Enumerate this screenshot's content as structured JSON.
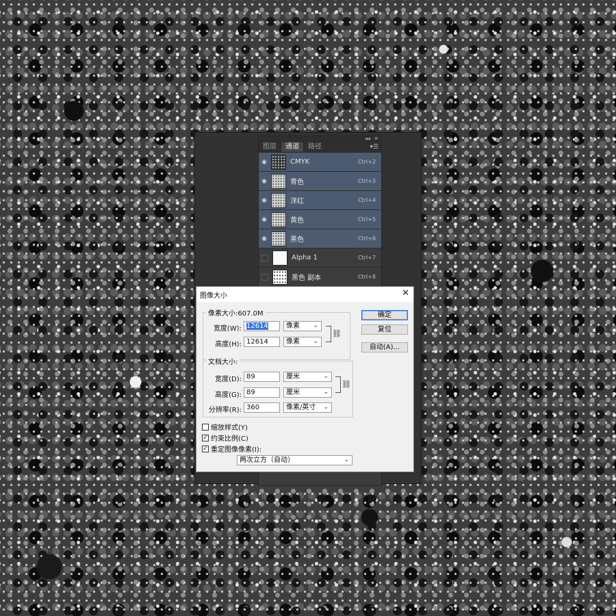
{
  "channels_panel": {
    "tabs": [
      "图层",
      "通道",
      "路径"
    ],
    "active_tab": "通道",
    "channels": [
      {
        "name": "CMYK",
        "shortcut": "Ctrl+2",
        "visible": true,
        "selected": true,
        "thumb": "dark"
      },
      {
        "name": "青色",
        "shortcut": "Ctrl+3",
        "visible": true,
        "selected": true,
        "thumb": "gray"
      },
      {
        "name": "洋红",
        "shortcut": "Ctrl+4",
        "visible": true,
        "selected": true,
        "thumb": "gray"
      },
      {
        "name": "黄色",
        "shortcut": "Ctrl+5",
        "visible": true,
        "selected": true,
        "thumb": "gray"
      },
      {
        "name": "黑色",
        "shortcut": "Ctrl+6",
        "visible": true,
        "selected": true,
        "thumb": "gray"
      },
      {
        "name": "Alpha 1",
        "shortcut": "Ctrl+7",
        "visible": false,
        "selected": false,
        "thumb": "white"
      },
      {
        "name": "黑色 副本",
        "shortcut": "Ctrl+8",
        "visible": false,
        "selected": false,
        "thumb": "speck"
      }
    ],
    "collapse_icon": "double-chevron-icon",
    "close_icon": "close-icon",
    "menu_icon": "panel-menu-icon"
  },
  "dialog": {
    "title": "图像大小",
    "close_glyph": "✕",
    "pixel_dimensions": {
      "legend": "像素大小:607.0M",
      "width_label": "宽度(W):",
      "width_value": "12614",
      "width_unit": "像素",
      "height_label": "高度(H):",
      "height_value": "12614",
      "height_unit": "像素"
    },
    "document_size": {
      "legend": "文档大小:",
      "width_label": "宽度(D):",
      "width_value": "89",
      "width_unit": "厘米",
      "height_label": "高度(G):",
      "height_value": "89",
      "height_unit": "厘米",
      "resolution_label": "分辨率(R):",
      "resolution_value": "360",
      "resolution_unit": "像素/英寸"
    },
    "buttons": {
      "ok": "确定",
      "reset": "复位",
      "auto": "自动(A)..."
    },
    "options": {
      "scale_styles": {
        "label": "缩放样式(Y)",
        "checked": false
      },
      "constrain": {
        "label": "约束比例(C)",
        "checked": true
      },
      "resample": {
        "label": "重定图像像素(I):",
        "checked": true
      }
    },
    "resample_method": "两次立方（自动）"
  },
  "colors": {
    "selected_row": "#4d5b70",
    "accent": "#3a78d6"
  }
}
